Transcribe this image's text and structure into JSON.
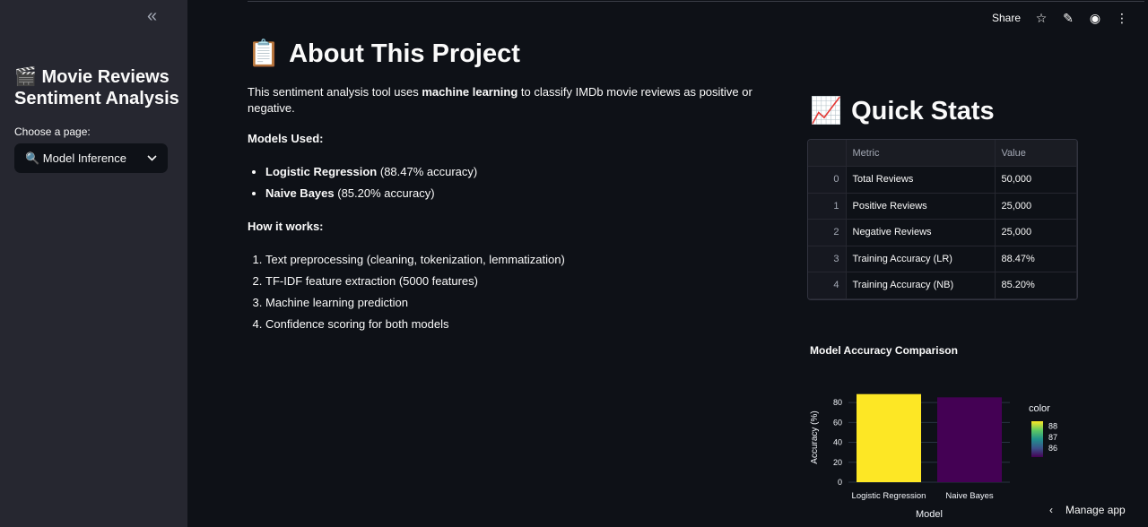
{
  "sidebar": {
    "title": "🎬 Movie Reviews Sentiment Analysis",
    "select_label": "Choose a page:",
    "selected_page": "🔍 Model Inference",
    "collapse_icon": "«"
  },
  "toolbar": {
    "share_label": "Share",
    "star_icon": "☆",
    "edit_icon": "✎",
    "github_icon": "◉",
    "menu_icon": "⋮"
  },
  "about": {
    "icon": "📋",
    "title": "About This Project",
    "desc_pre": "This sentiment analysis tool uses ",
    "desc_bold": "machine learning",
    "desc_post": " to classify IMDb movie reviews as positive or negative.",
    "models_heading": "Models Used:",
    "models": [
      {
        "name": "Logistic Regression",
        "detail": " (88.47% accuracy)"
      },
      {
        "name": "Naive Bayes",
        "detail": " (85.20% accuracy)"
      }
    ],
    "how_heading": "How it works:",
    "steps": [
      "Text preprocessing (cleaning, tokenization, lemmatization)",
      "TF-IDF feature extraction (5000 features)",
      "Machine learning prediction",
      "Confidence scoring for both models"
    ]
  },
  "quick_stats": {
    "icon": "📈",
    "title": "Quick Stats",
    "columns": [
      "",
      "Metric",
      "Value"
    ],
    "rows": [
      {
        "idx": "0",
        "metric": "Total Reviews",
        "value": "50,000"
      },
      {
        "idx": "1",
        "metric": "Positive Reviews",
        "value": "25,000"
      },
      {
        "idx": "2",
        "metric": "Negative Reviews",
        "value": "25,000"
      },
      {
        "idx": "3",
        "metric": "Training Accuracy (LR)",
        "value": "88.47%"
      },
      {
        "idx": "4",
        "metric": "Training Accuracy (NB)",
        "value": "85.20%"
      }
    ]
  },
  "chart_data": {
    "type": "bar",
    "title": "Model Accuracy Comparison",
    "categories": [
      "Logistic Regression",
      "Naive Bayes"
    ],
    "values": [
      88.47,
      85.2
    ],
    "xlabel": "Model",
    "ylabel": "Accuracy (%)",
    "ylim": [
      0,
      90
    ],
    "yticks": [
      0,
      20,
      40,
      60,
      80
    ],
    "bar_colors": [
      "#fde725",
      "#440154"
    ],
    "colorbar": {
      "title": "color",
      "ticks": [
        86,
        87,
        88
      ]
    },
    "grid": true
  },
  "footer": {
    "manage_icon": "‹",
    "manage_label": "Manage app"
  }
}
